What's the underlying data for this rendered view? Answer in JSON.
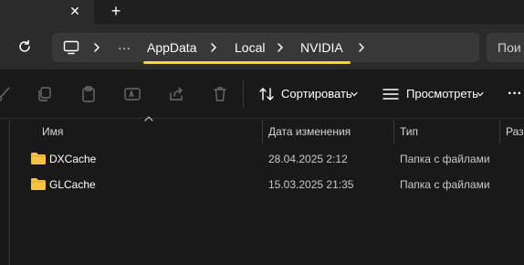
{
  "tabs": {
    "close_glyph": "✕",
    "new_tab_glyph": "+"
  },
  "address": {
    "overflow_label": "···",
    "crumbs": [
      "AppData",
      "Local",
      "NVIDIA"
    ],
    "search_placeholder": "Пои",
    "highlight_color": "#f2de18"
  },
  "toolbar": {
    "sort_label": "Сортировать",
    "view_label": "Просмотреть",
    "more_label": "···",
    "icons": [
      "cut-icon",
      "copy-icon",
      "paste-icon",
      "rename-icon",
      "share-icon",
      "delete-icon"
    ]
  },
  "columns": {
    "name": "Имя",
    "date": "Дата изменения",
    "type": "Тип",
    "size": "Раз"
  },
  "files": [
    {
      "name": "DXCache",
      "date": "28.04.2025 2:12",
      "type": "Папка с файлами"
    },
    {
      "name": "GLCache",
      "date": "15.03.2025 21:35",
      "type": "Папка с файлами"
    }
  ],
  "colors": {
    "folder": "#f5c242",
    "background": "#191919",
    "bar": "#2b2b2b"
  }
}
